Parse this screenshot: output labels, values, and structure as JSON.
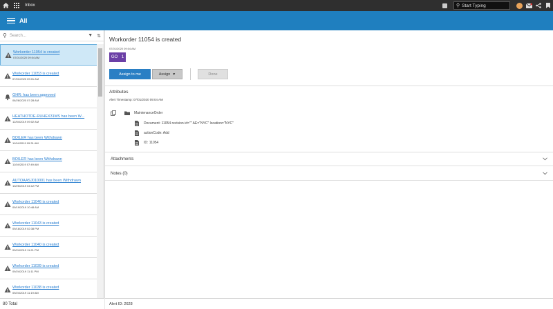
{
  "topbar": {
    "app_title": "Inbox",
    "search_placeholder": "Start Typing"
  },
  "header": {
    "title": "All"
  },
  "sidebar": {
    "search_placeholder": "Search...",
    "total": "80 Total",
    "items": [
      {
        "title": "Workorder 11054 is created",
        "date": "07/01/2020 09:04 AM",
        "icon": "warning-icon",
        "selected": true
      },
      {
        "title": "Workorder 11053 is created",
        "date": "07/01/2020 09:01 AM",
        "icon": "warning-icon"
      },
      {
        "title": "GHR: has been approved",
        "date": "06/26/2020 07:28 AM",
        "icon": "bell-icon"
      },
      {
        "title": "HEATHOTDE-RUHEX31MS has been W...",
        "date": "12/04/2019 09:02 AM",
        "icon": "warning-icon"
      },
      {
        "title": "BOILER has been Withdrawn",
        "date": "11/04/2019 09:31 AM",
        "icon": "warning-icon"
      },
      {
        "title": "BOILER has been Withdrawn",
        "date": "11/04/2019 07:49 AM",
        "icon": "warning-icon"
      },
      {
        "title": "AUTOAASJ010001 has been Withdrawn",
        "date": "10/25/2019 04:12 PM",
        "icon": "warning-icon"
      },
      {
        "title": "Workorder 11046 is created",
        "date": "09/19/2019 10:48 AM",
        "icon": "warning-icon"
      },
      {
        "title": "Workorder 11043 is created",
        "date": "09/18/2019 02:38 PM",
        "icon": "warning-icon"
      },
      {
        "title": "Workorder 11040 is created",
        "date": "09/24/2019 11:21 PM",
        "icon": "warning-icon"
      },
      {
        "title": "Workorder 11039 is created",
        "date": "09/24/2019 11:11 PM",
        "icon": "warning-icon"
      },
      {
        "title": "Workorder 11038 is created",
        "date": "09/24/2019 11:19 AM",
        "icon": "warning-icon"
      }
    ]
  },
  "detail": {
    "title": "Workorder 11054 is created",
    "date": "07/01/2020 09:04 AM",
    "badge_label": "GO",
    "badge_count": "1",
    "assign_me_label": "Assign to me",
    "assign_label": "Assign",
    "done_label": "Done",
    "attributes_title": "Attributes",
    "alert_timestamp": "Alert Timestamp: 07/01/2020 09:04 AM",
    "tree_root": "MaintenanceOrder",
    "tree_items": [
      "Document: 11054 revision id=\"\" AE=\"NYC\" location=\"NYC\"",
      "actionCode: Add",
      "ID: 11054"
    ],
    "attachments_label": "Attachments",
    "notes_label": "Notes (0)",
    "alert_id": "Alert ID: 2628"
  }
}
